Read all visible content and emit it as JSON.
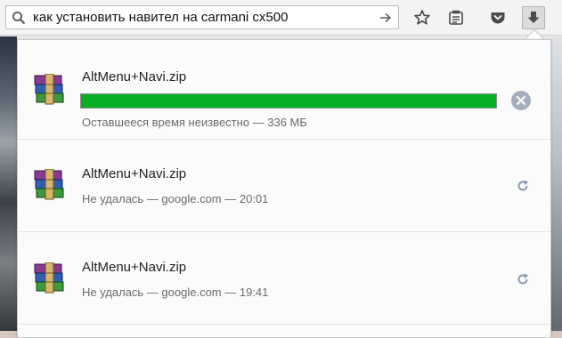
{
  "toolbar": {
    "url_text": "как установить навител на carmani cx500",
    "icons": [
      "search-icon",
      "go-arrow-icon",
      "bookmark-star-icon",
      "reader-view-icon",
      "pocket-icon",
      "downloads-icon"
    ]
  },
  "downloads": [
    {
      "filename": "AltMenu+Navi.zip",
      "status": "Оставшееся время неизвестно — 336 МБ",
      "state": "downloading",
      "progress": 1.0,
      "action": "cancel"
    },
    {
      "filename": "AltMenu+Navi.zip",
      "status": "Не удалась — google.com — 20:01",
      "state": "failed",
      "action": "retry"
    },
    {
      "filename": "AltMenu+Navi.zip",
      "status": "Не удалась — google.com — 19:41",
      "state": "failed",
      "action": "retry"
    }
  ],
  "colors": {
    "progress_fill": "#06b025",
    "cancel_button": "#a4aebf",
    "retry_icon": "#8e9aab"
  }
}
